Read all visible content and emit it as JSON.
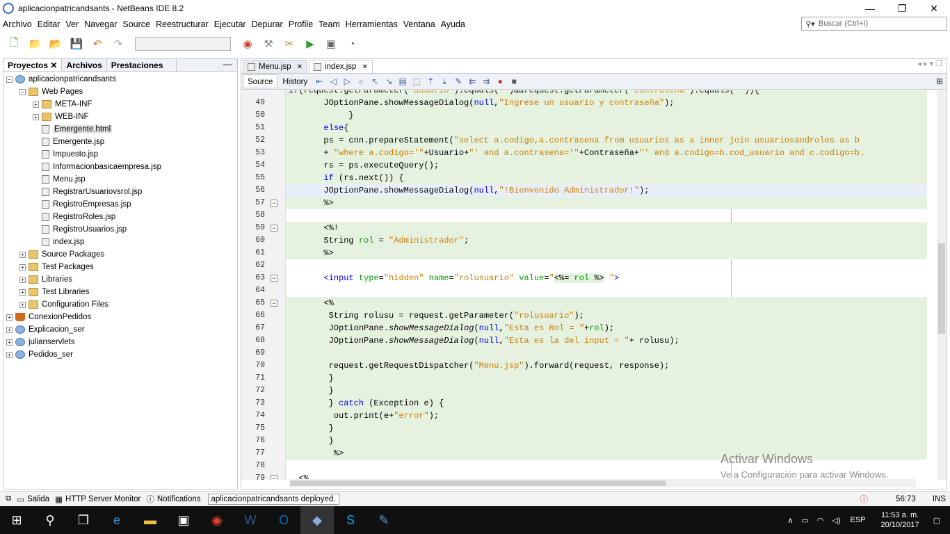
{
  "window": {
    "title": "aplicacionpatricandsants - NetBeans IDE 8.2",
    "minimize": "—",
    "maximize": "❐",
    "close": "✕"
  },
  "menu": [
    "Archivo",
    "Editar",
    "Ver",
    "Navegar",
    "Source",
    "Reestructurar",
    "Ejecutar",
    "Depurar",
    "Profile",
    "Team",
    "Herramientas",
    "Ventana",
    "Ayuda"
  ],
  "search": {
    "placeholder": "Buscar (Ctrl+I)"
  },
  "panel": {
    "tabs": [
      "Proyectos",
      "Archivos",
      "Prestaciones"
    ],
    "minimize": "—"
  },
  "tree": [
    {
      "label": "aplicacionpatricandsants",
      "depth": 0,
      "exp": "−",
      "icon": "globe"
    },
    {
      "label": "Web Pages",
      "depth": 1,
      "exp": "−",
      "icon": "folder"
    },
    {
      "label": "META-INF",
      "depth": 2,
      "exp": "+",
      "icon": "folder"
    },
    {
      "label": "WEB-INF",
      "depth": 2,
      "exp": "+",
      "icon": "folder"
    },
    {
      "label": "Emergente.html",
      "depth": 2,
      "exp": "",
      "icon": "file",
      "selected": true
    },
    {
      "label": "Emergente.jsp",
      "depth": 2,
      "exp": "",
      "icon": "file"
    },
    {
      "label": "Impuesto.jsp",
      "depth": 2,
      "exp": "",
      "icon": "file"
    },
    {
      "label": "Informacionbasicaempresa.jsp",
      "depth": 2,
      "exp": "",
      "icon": "file"
    },
    {
      "label": "Menu.jsp",
      "depth": 2,
      "exp": "",
      "icon": "file"
    },
    {
      "label": "RegistrarUsuariovsrol.jsp",
      "depth": 2,
      "exp": "",
      "icon": "file"
    },
    {
      "label": "RegistroEmpresas.jsp",
      "depth": 2,
      "exp": "",
      "icon": "file"
    },
    {
      "label": "RegistroRoles.jsp",
      "depth": 2,
      "exp": "",
      "icon": "file"
    },
    {
      "label": "RegistroUsuarios.jsp",
      "depth": 2,
      "exp": "",
      "icon": "file"
    },
    {
      "label": "index.jsp",
      "depth": 2,
      "exp": "",
      "icon": "file"
    },
    {
      "label": "Source Packages",
      "depth": 1,
      "exp": "+",
      "icon": "folder"
    },
    {
      "label": "Test Packages",
      "depth": 1,
      "exp": "+",
      "icon": "folder"
    },
    {
      "label": "Libraries",
      "depth": 1,
      "exp": "+",
      "icon": "folder"
    },
    {
      "label": "Test Libraries",
      "depth": 1,
      "exp": "+",
      "icon": "folder"
    },
    {
      "label": "Configuration Files",
      "depth": 1,
      "exp": "+",
      "icon": "folder"
    },
    {
      "label": "ConexionPedidos",
      "depth": 0,
      "exp": "+",
      "icon": "cup"
    },
    {
      "label": "Explicacion_ser",
      "depth": 0,
      "exp": "+",
      "icon": "globe"
    },
    {
      "label": "julianservlets",
      "depth": 0,
      "exp": "+",
      "icon": "globe"
    },
    {
      "label": "Pedidos_ser",
      "depth": 0,
      "exp": "+",
      "icon": "globe"
    }
  ],
  "editor": {
    "tabs": [
      {
        "label": "Menu.jsp",
        "active": false
      },
      {
        "label": "index.jsp",
        "active": true
      }
    ],
    "source": "Source",
    "history": "History"
  },
  "code": [
    {
      "n": "",
      "bg": "jv",
      "h": "<span class='kw'>if</span>(request.getParameter(<span class='st'>\"usuario\"</span>).equals(<span class='st'>\"\"</span>)&amp;&amp;request.getParameter(<span class='st'>\"contrasena\"</span>).equals(<span class='st'>\"\"</span>)){"
    },
    {
      "n": "49",
      "bg": "jv",
      "h": "       JOptionPane.showMessageDialog(<span class='kw'>null</span>,<span class='st'>\"Ingrese un usuario y contraseña\"</span>);"
    },
    {
      "n": "50",
      "bg": "jv",
      "h": "            }"
    },
    {
      "n": "51",
      "bg": "jv",
      "h": "       <span class='kw'>else</span>{"
    },
    {
      "n": "52",
      "bg": "jv",
      "h": "       ps = cnn.prepareStatement(<span class='st'>\"select a.codigo,a.contrasena from usuarios as a inner join usuariosandroles as b</span>"
    },
    {
      "n": "53",
      "bg": "jv",
      "h": "       + <span class='st'>\"where a.codigo='\"</span>+Usuario+<span class='st'>\"' and a.contrasena='\"</span>+Contraseña+<span class='st'>\"' and a.codigo=b.cod_usuario and c.codigo=b.</span>"
    },
    {
      "n": "54",
      "bg": "jv",
      "h": "       rs = ps.executeQuery();"
    },
    {
      "n": "55",
      "bg": "jv",
      "h": "       <span class='kw'>if</span> (rs.next()) {"
    },
    {
      "n": "56",
      "bg": "cur",
      "h": "       JOptionPane.showMessageDialog(<span class='kw'>null</span>,<span class='st'>\"!Bienvenido Administrador!\"</span>);"
    },
    {
      "n": "57",
      "bg": "jv",
      "h": "       %&gt;",
      "fold": "−"
    },
    {
      "n": "58",
      "bg": "",
      "h": ""
    },
    {
      "n": "59",
      "bg": "jv",
      "h": "       &lt;%!",
      "fold": "−"
    },
    {
      "n": "60",
      "bg": "jv",
      "h": "       String <span class='vr'>rol</span> = <span class='st'>\"Administrador\"</span>;"
    },
    {
      "n": "61",
      "bg": "jv",
      "h": "       %&gt;"
    },
    {
      "n": "62",
      "bg": "",
      "h": ""
    },
    {
      "n": "63",
      "bg": "",
      "h": "       <span class='tg'>&lt;input</span> <span class='at'>type</span>=<span class='st'>\"hidden\"</span> <span class='at'>name</span>=<span class='st'>\"rolusuario\"</span> <span class='at'>value</span>=<span class='st'>\"</span><span style='background:#e6f2e0'>&lt;%= <span class='vr'>rol</span> %&gt;</span><span class='st'> \"</span><span class='tg'>&gt;</span>",
      "fold": "−"
    },
    {
      "n": "64",
      "bg": "",
      "h": ""
    },
    {
      "n": "65",
      "bg": "jv",
      "h": "       &lt;%",
      "fold": "−"
    },
    {
      "n": "66",
      "bg": "jv",
      "h": "        String rolusu = request.getParameter(<span class='st'>\"rolusuario\"</span>);"
    },
    {
      "n": "67",
      "bg": "jv",
      "h": "        JOptionPane.<span class='it'>showMessageDialog</span>(<span class='kw'>null</span>,<span class='st'>\"Esta es Rol = \"</span>+<span class='vr'>rol</span>);"
    },
    {
      "n": "68",
      "bg": "jv",
      "h": "        JOptionPane.<span class='it'>showMessageDialog</span>(<span class='kw'>null</span>,<span class='st'>\"Esta es la del input = \"</span>+ rolusu);"
    },
    {
      "n": "69",
      "bg": "jv",
      "h": ""
    },
    {
      "n": "70",
      "bg": "jv",
      "h": "        request.getRequestDispatcher(<span class='st'>\"Menu.jsp\"</span>).forward(request, response);"
    },
    {
      "n": "71",
      "bg": "jv",
      "h": "        }"
    },
    {
      "n": "72",
      "bg": "jv",
      "h": "        }"
    },
    {
      "n": "73",
      "bg": "jv",
      "h": "        } <span class='kw'>catch</span> (Exception e) {"
    },
    {
      "n": "74",
      "bg": "jv",
      "h": "         out.print(e+<span class='st'>\"error\"</span>);"
    },
    {
      "n": "75",
      "bg": "jv",
      "h": "        }"
    },
    {
      "n": "76",
      "bg": "jv",
      "h": "        }"
    },
    {
      "n": "77",
      "bg": "jv",
      "h": "         %&gt;"
    },
    {
      "n": "78",
      "bg": "",
      "h": ""
    },
    {
      "n": "79",
      "bg": "",
      "h": "  &lt;%",
      "fold": "−"
    }
  ],
  "watermark": {
    "line1": "Activar Windows",
    "line2": "Ve a Configuración para activar Windows."
  },
  "status": {
    "salida": "Salida",
    "http": "HTTP Server Monitor",
    "notifications": "Notifications",
    "message": "aplicacionpatricandsants deployed.",
    "position": "56:73",
    "mode": "INS"
  },
  "taskbar": {
    "lang": "ESP",
    "time": "11:53 a. m.",
    "date": "20/10/2017"
  }
}
